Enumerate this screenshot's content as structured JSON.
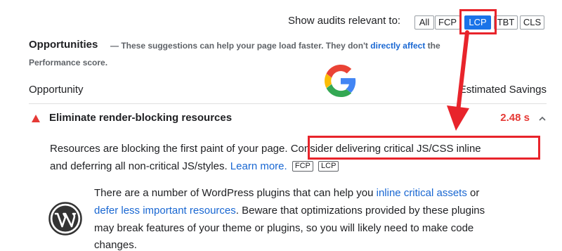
{
  "filter": {
    "label": "Show audits relevant to:",
    "chips": [
      {
        "label": "All",
        "active": false
      },
      {
        "label": "FCP",
        "active": false
      },
      {
        "label": "LCP",
        "active": true
      },
      {
        "label": "TBT",
        "active": false
      },
      {
        "label": "CLS",
        "active": false
      }
    ]
  },
  "opportunities": {
    "title": "Opportunities",
    "desc_prefix": "— These suggestions can help your page load faster. They don't",
    "desc_link": "directly affect",
    "desc_suffix": "the",
    "desc_line2": "Performance score.",
    "col_opportunity": "Opportunity",
    "col_savings": "Estimated Savings"
  },
  "audit": {
    "icon": "warning-triangle-icon",
    "title": "Eliminate render-blocking resources",
    "saving": "2.48 s",
    "status_color": "#e53935",
    "desc_line1_a": "Resources are blocking the first paint of your page.",
    "desc_line1_b": "Consider delivering critical JS/CSS inline",
    "desc_line2": "and deferring all non-critical JS/styles.",
    "learn_more": "Learn more.",
    "tags": [
      "FCP",
      "LCP"
    ]
  },
  "wordpress": {
    "icon": "wordpress-logo-icon",
    "line1_a": "There are a number of WordPress plugins that can help you",
    "line1_link": "inline critical assets",
    "line1_b": "or",
    "line2_link": "defer less important resources",
    "line2_b": ". Beware that optimizations provided by these plugins",
    "line3": "may break features of your theme or plugins, so you will likely need to make code",
    "line4": "changes."
  },
  "overlay": {
    "icon": "google-g-logo-icon",
    "highlight_color": "#e8242b"
  }
}
